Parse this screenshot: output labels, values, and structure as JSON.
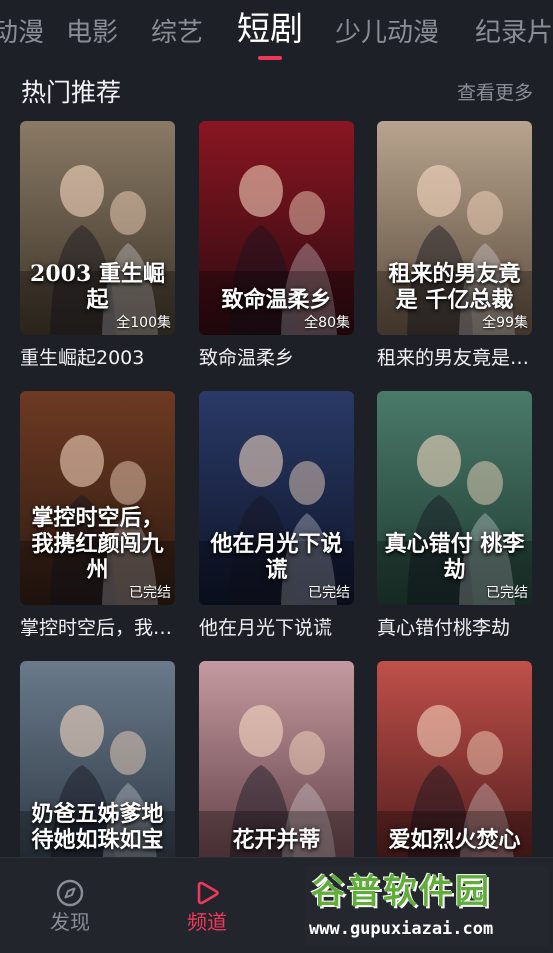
{
  "tabs": {
    "items": [
      {
        "label": "动漫"
      },
      {
        "label": "电影"
      },
      {
        "label": "综艺"
      },
      {
        "label": "短剧"
      },
      {
        "label": "少儿动漫"
      },
      {
        "label": "纪录片"
      }
    ],
    "active_index": 3
  },
  "section": {
    "title": "热门推荐",
    "more_label": "查看更多"
  },
  "cards": [
    {
      "title": "重生崛起2003",
      "badge": "全100集",
      "poster_title": "2003 重生崛起",
      "colors": [
        "#8a7a66",
        "#3b3226"
      ]
    },
    {
      "title": "致命温柔乡",
      "badge": "全80集",
      "poster_title": "致命温柔乡",
      "colors": [
        "#8a1622",
        "#2a0a10"
      ]
    },
    {
      "title": "租来的男友竟是千亿总裁",
      "badge": "全99集",
      "poster_title": "租来的男友竟是 千亿总裁",
      "colors": [
        "#b8a48e",
        "#5a4a3c"
      ]
    },
    {
      "title": "掌控时空后，我携红颜闯九州",
      "badge": "已完结",
      "poster_title": "掌控时空后，我携红颜闯九州",
      "colors": [
        "#6e3a22",
        "#2a1a12"
      ]
    },
    {
      "title": "他在月光下说谎",
      "badge": "已完结",
      "poster_title": "他在月光下说谎",
      "colors": [
        "#2a3a66",
        "#0e1428"
      ]
    },
    {
      "title": "真心错付桃李劫",
      "badge": "已完结",
      "poster_title": "真心错付 桃李劫",
      "colors": [
        "#4a7a6a",
        "#1e3a30"
      ]
    },
    {
      "title": "",
      "badge": "",
      "poster_title": "奶爸五姊爹地 待她如珠如宝",
      "colors": [
        "#6a7a8a",
        "#2a3440"
      ]
    },
    {
      "title": "",
      "badge": "",
      "poster_title": "花开并蒂",
      "colors": [
        "#c49aa0",
        "#5a3a40"
      ]
    },
    {
      "title": "",
      "badge": "",
      "poster_title": "爱如烈火焚心",
      "colors": [
        "#c0504a",
        "#4a1a1a"
      ]
    }
  ],
  "bottom_nav": {
    "items": [
      {
        "label": "发现",
        "icon": "compass-icon"
      },
      {
        "label": "频道",
        "icon": "play-icon"
      }
    ],
    "active_index": 1,
    "active_color": "#f0385b"
  },
  "watermark": {
    "logo": "谷普软件园",
    "url": "www.gupuxiazai.com"
  }
}
